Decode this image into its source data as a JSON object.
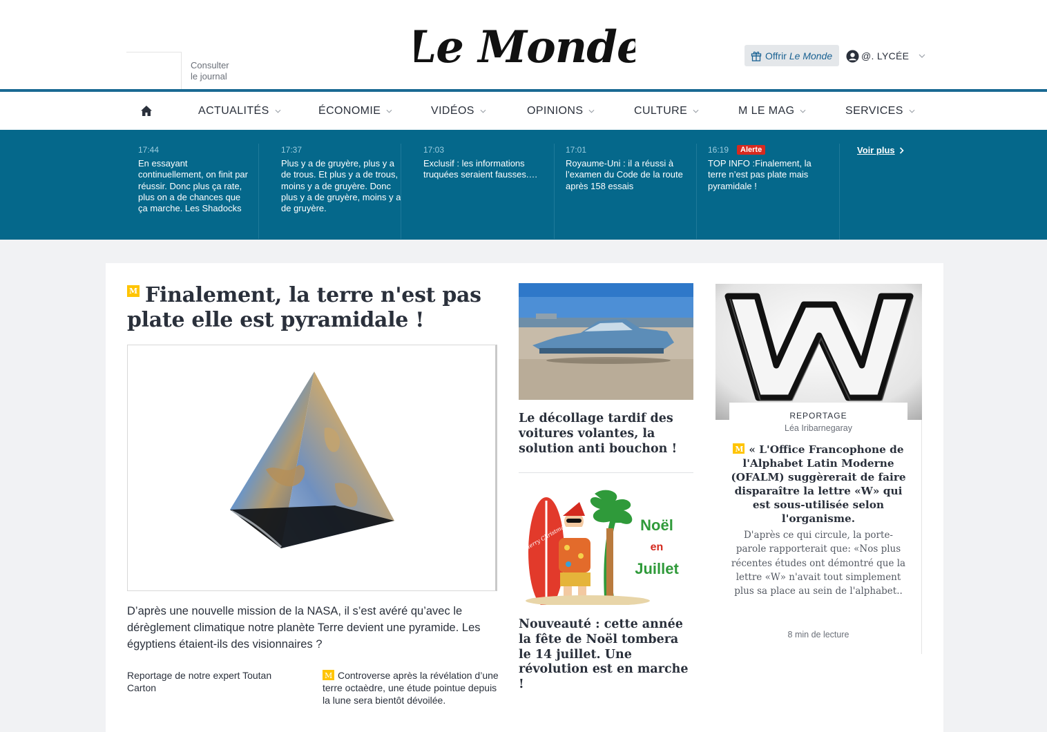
{
  "header": {
    "journal_link": "Consulter le journal",
    "logo_text": "Le Monde",
    "offer_prefix": "Offrir",
    "offer_brand": "Le Monde",
    "account_label": "@. LYCÉE"
  },
  "nav": {
    "items": [
      {
        "label": "ACTUALITÉS"
      },
      {
        "label": "ÉCONOMIE"
      },
      {
        "label": "VIDÉOS"
      },
      {
        "label": "OPINIONS"
      },
      {
        "label": "CULTURE"
      },
      {
        "label": "M LE MAG"
      },
      {
        "label": "SERVICES"
      }
    ]
  },
  "live": {
    "items": [
      {
        "time": "17:44",
        "text": "En essayant continuellement, on finit par réussir. Donc plus ça rate, plus on a de chances que ça marche. Les Shadocks"
      },
      {
        "time": "17:37",
        "text": "Plus y a de gruyère, plus y a de trous. Et plus y a de trous, moins y a de gruyère. Donc plus y a de gruyère, moins y a de gruyère."
      },
      {
        "time": "17:03",
        "text": "Exclusif : les informations truquées seraient fausses.…"
      },
      {
        "time": "17:01",
        "text": "Royaume-Uni : il a réussi à l’examen du Code de la route après 158 essais"
      },
      {
        "time": "16:19",
        "badge": "Alerte",
        "text": "TOP INFO :Finalement, la terre n’est pas plate mais pyramidale !"
      }
    ],
    "see_more": "Voir plus"
  },
  "main": {
    "badge": "M",
    "title": "Finalement, la terre n'est pas plate elle est pyramidale !",
    "description": "D’après une nouvelle mission de la NASA, il s’est avéré qu’avec le dérèglement climatique notre planète Terre devient une pyramide. Les égyptiens étaient-ils des visionnaires ?",
    "byline": "Reportage de notre expert Toutan Carton",
    "related": "Controverse après la révélation d’une terre octaèdre, une étude pointue depuis la lune sera bientôt dévoilée."
  },
  "middle": {
    "article1_title": "Le décollage tardif des voitures volantes, la solution anti bouchon !",
    "article2_title": "Nouveauté : cette année la fête de Noël tombera le 14 juillet. Une révolution est en marche !",
    "image2": {
      "line1": "Noël",
      "line2": "en",
      "line3": "Juillet",
      "surf_text": "Merry Christmas"
    }
  },
  "right": {
    "kicker": "REPORTAGE",
    "author": "Léa Iribarnegaray",
    "title": "« L'Office Francophone de l'Alphabet Latin Moderne (OFALM) suggèrerait de faire disparaître la lettre «W» qui est sous-utilisée selon l'organisme.",
    "description": "D'après ce qui circule, la porte-parole rapporterait que: «Nos plus récentes études ont démontré que la lettre «W» n'avait tout simplement plus sa place au sein de l'alphabet..",
    "reading_time": "8 min de lecture"
  },
  "colors": {
    "brand_blue": "#05688b",
    "link_blue": "#1a6293",
    "alert_red": "#d82a1f",
    "abo_yellow": "#ffc400"
  }
}
